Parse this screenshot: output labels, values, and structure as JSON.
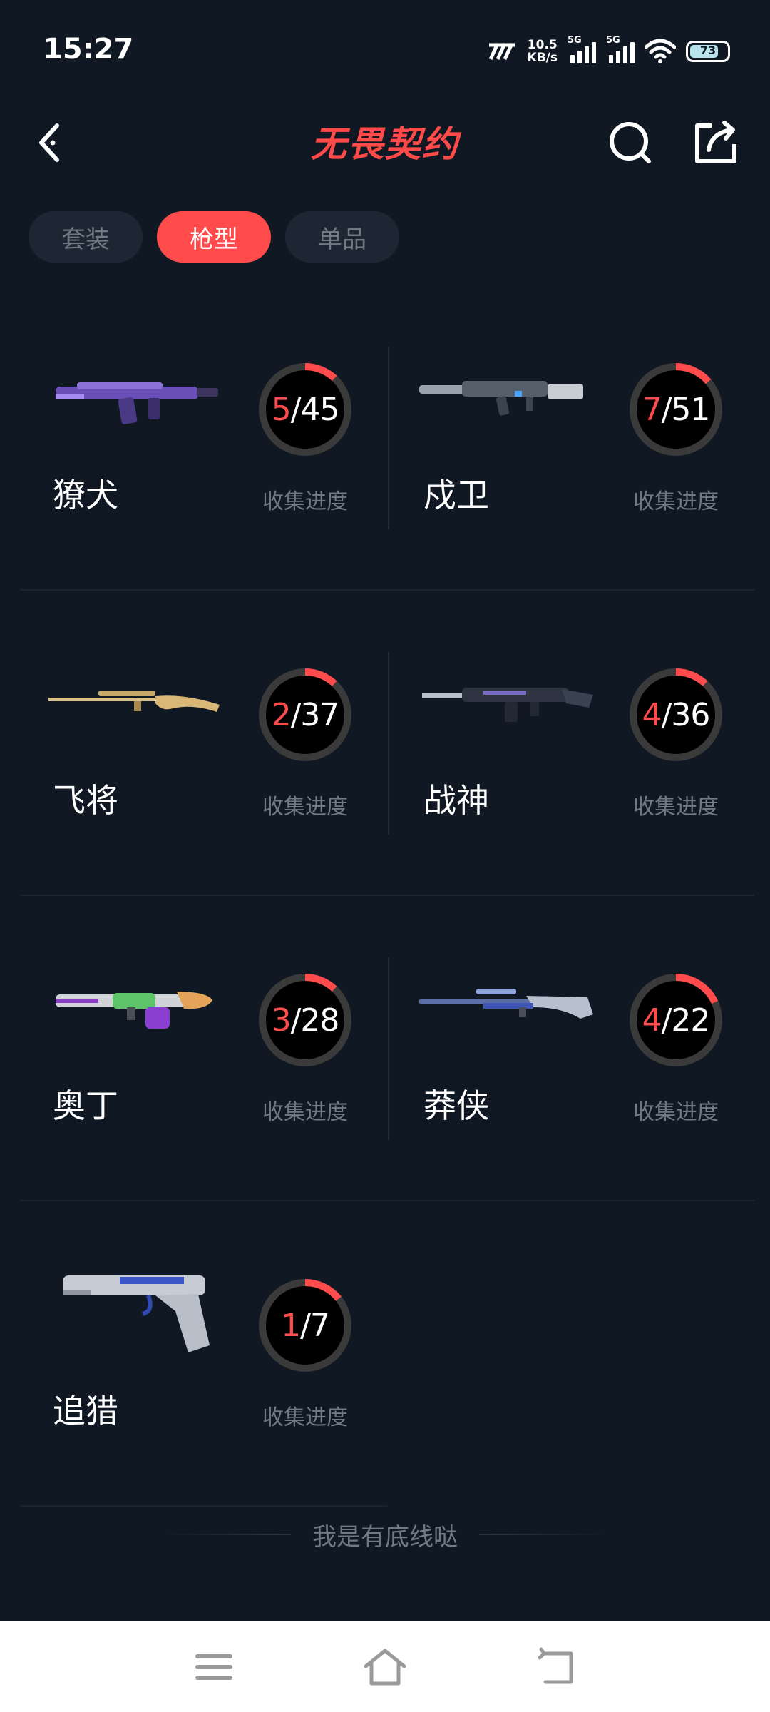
{
  "status_bar": {
    "time": "15:27",
    "net_speed_value": "10.5",
    "net_speed_unit": "KB/s",
    "signal1_label": "5G",
    "signal2_label": "5G",
    "battery": "73"
  },
  "header": {
    "title": "无畏契约",
    "icons": [
      "back-icon",
      "search-icon",
      "share-icon"
    ]
  },
  "tabs": [
    {
      "label": "套装",
      "active": false
    },
    {
      "label": "枪型",
      "active": true
    },
    {
      "label": "单品",
      "active": false
    }
  ],
  "weapons": [
    {
      "name": "獠犬",
      "collected": "5",
      "total": "45",
      "progress_label": "收集进度"
    },
    {
      "name": "戍卫",
      "collected": "7",
      "total": "51",
      "progress_label": "收集进度"
    },
    {
      "name": "飞将",
      "collected": "2",
      "total": "37",
      "progress_label": "收集进度"
    },
    {
      "name": "战神",
      "collected": "4",
      "total": "36",
      "progress_label": "收集进度"
    },
    {
      "name": "奥丁",
      "collected": "3",
      "total": "28",
      "progress_label": "收集进度"
    },
    {
      "name": "莽侠",
      "collected": "4",
      "total": "22",
      "progress_label": "收集进度"
    },
    {
      "name": "追猎",
      "collected": "1",
      "total": "7",
      "progress_label": "收集进度"
    }
  ],
  "footer_note": "我是有底线哒",
  "colors": {
    "background": "#0f1823",
    "accent": "#ff4b4b",
    "tab_inactive": "#1c2733",
    "muted_text": "#6f7a85"
  },
  "nav_bar": [
    "menu-icon",
    "home-icon",
    "back-nav-icon"
  ]
}
